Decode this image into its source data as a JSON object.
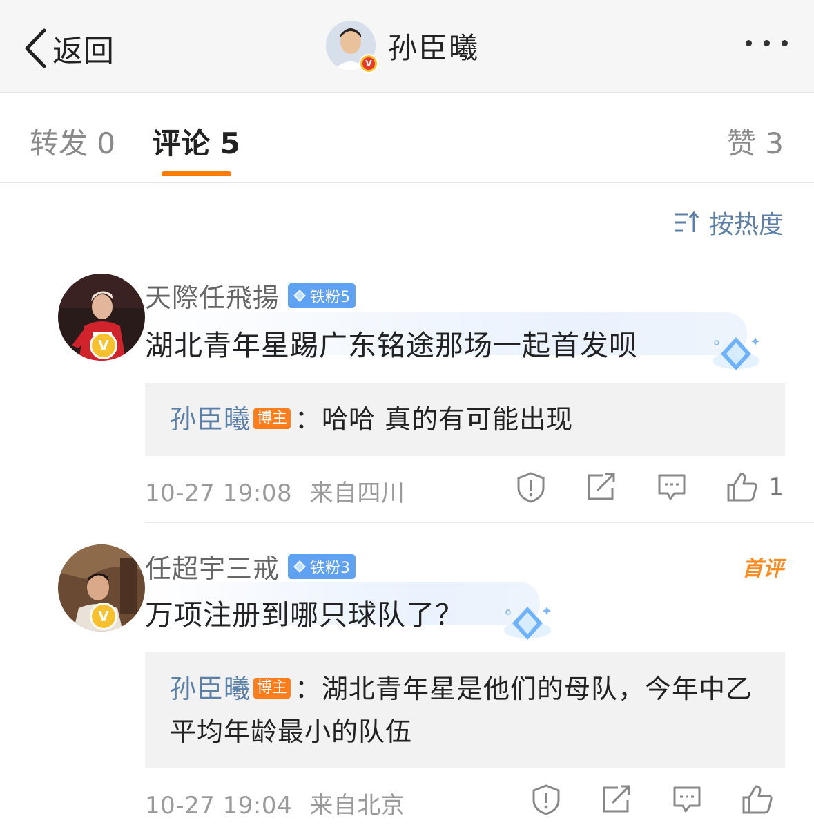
{
  "header": {
    "back_label": "返回",
    "author_name": "孙臣曦",
    "verified_mark": "V"
  },
  "tabs": {
    "repost": "转发 0",
    "comments": "评论 5",
    "likes": "赞 3"
  },
  "sort_label": "按热度",
  "comments": [
    {
      "user": "天際任飛揚",
      "fan_badge": "铁粉5",
      "verified_mark": "V",
      "text": "湖北青年星踢广东铭途那场一起首发呗",
      "reply": {
        "name": "孙臣曦",
        "tag": "博主",
        "text": "：哈哈 真的有可能出现"
      },
      "time": "10-27 19:08",
      "location": "来自四川",
      "like_count": "1"
    },
    {
      "user": "任超宇三戒",
      "fan_badge": "铁粉3",
      "verified_mark": "V",
      "first_tag": "首评",
      "text": "万项注册到哪只球队了？",
      "reply": {
        "name": "孙臣曦",
        "tag": "博主",
        "text": "：湖北青年星是他们的母队，今年中乙平均年龄最小的队伍"
      },
      "time": "10-27 19:04",
      "location": "来自北京",
      "like_count": ""
    }
  ],
  "colors": {
    "accent_orange": "#ff7d00",
    "link_blue": "#5b7fa6",
    "fan_badge_blue": "#5fa1f2",
    "verified_gold": "#f7c12e"
  },
  "icons": [
    "back-chevron-icon",
    "more-dots-icon",
    "sort-icon",
    "report-icon",
    "share-icon",
    "comment-icon",
    "like-icon",
    "diamond-icon"
  ]
}
